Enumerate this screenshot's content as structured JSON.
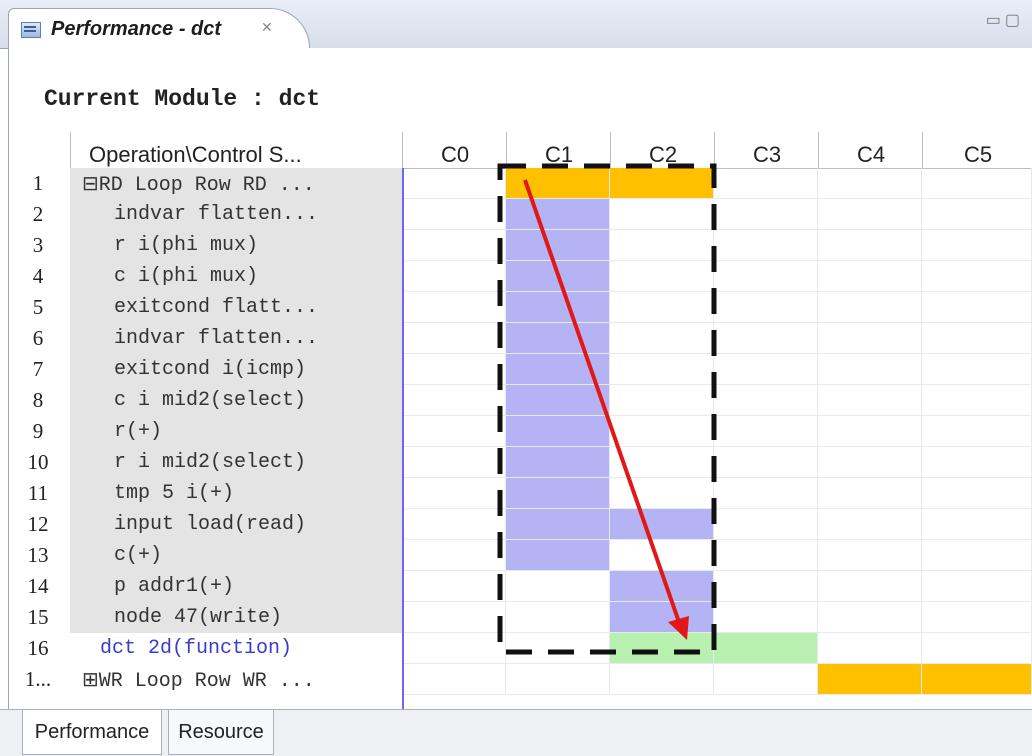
{
  "window": {
    "tab_title": "Performance - dct",
    "module_label": "Current Module : dct"
  },
  "table": {
    "op_header": "Operation\\Control S...",
    "columns": [
      "C0",
      "C1",
      "C2",
      "C3",
      "C4",
      "C5"
    ],
    "rows": [
      {
        "num": "1",
        "label": "⊟RD Loop Row RD ...",
        "cells": [
          "",
          "orange",
          "orange",
          "",
          "",
          ""
        ]
      },
      {
        "num": "2",
        "label": "indvar flatten...",
        "cells": [
          "",
          "blue",
          "",
          "",
          "",
          ""
        ]
      },
      {
        "num": "3",
        "label": "r i(phi mux)",
        "cells": [
          "",
          "blue",
          "",
          "",
          "",
          ""
        ]
      },
      {
        "num": "4",
        "label": "c i(phi mux)",
        "cells": [
          "",
          "blue",
          "",
          "",
          "",
          ""
        ]
      },
      {
        "num": "5",
        "label": "exitcond flatt...",
        "cells": [
          "",
          "blue",
          "",
          "",
          "",
          ""
        ]
      },
      {
        "num": "6",
        "label": "indvar flatten...",
        "cells": [
          "",
          "blue",
          "",
          "",
          "",
          ""
        ]
      },
      {
        "num": "7",
        "label": "exitcond i(icmp)",
        "cells": [
          "",
          "blue",
          "",
          "",
          "",
          ""
        ]
      },
      {
        "num": "8",
        "label": "c i mid2(select)",
        "cells": [
          "",
          "blue",
          "",
          "",
          "",
          ""
        ]
      },
      {
        "num": "9",
        "label": "r(+)",
        "cells": [
          "",
          "blue",
          "",
          "",
          "",
          ""
        ]
      },
      {
        "num": "10",
        "label": "r i mid2(select)",
        "cells": [
          "",
          "blue",
          "",
          "",
          "",
          ""
        ]
      },
      {
        "num": "11",
        "label": "tmp 5 i(+)",
        "cells": [
          "",
          "blue",
          "",
          "",
          "",
          ""
        ]
      },
      {
        "num": "12",
        "label": "input load(read)",
        "cells": [
          "",
          "blue",
          "blue",
          "",
          "",
          ""
        ]
      },
      {
        "num": "13",
        "label": "c(+)",
        "cells": [
          "",
          "blue",
          "",
          "",
          "",
          ""
        ]
      },
      {
        "num": "14",
        "label": "p addr1(+)",
        "cells": [
          "",
          "",
          "blue",
          "",
          "",
          ""
        ]
      },
      {
        "num": "15",
        "label": "node 47(write)",
        "cells": [
          "",
          "",
          "blue",
          "",
          "",
          ""
        ]
      },
      {
        "num": "16",
        "label": "dct 2d(function)",
        "cells": [
          "",
          "",
          "green",
          "green",
          "",
          ""
        ]
      },
      {
        "num": "1...",
        "label": "⊞WR Loop Row WR ...",
        "cells": [
          "",
          "",
          "",
          "",
          "orange",
          "orange"
        ]
      }
    ]
  },
  "bottom_tabs": [
    "Performance",
    "Resource"
  ],
  "colors": {
    "orange": "#ffc000",
    "blue": "#b4b4f4",
    "green": "#b8f0b0",
    "arrow": "#e21818"
  }
}
